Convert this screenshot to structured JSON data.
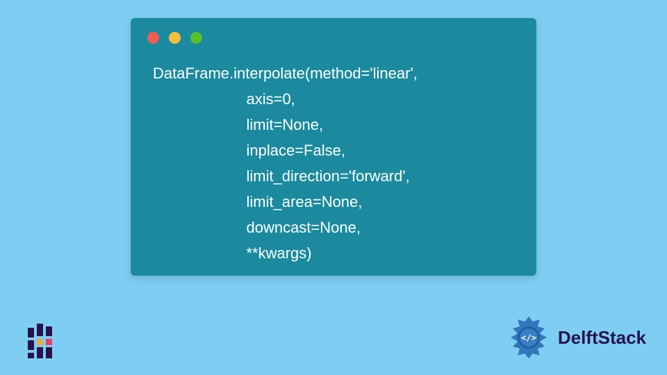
{
  "code": {
    "line1": "DataFrame.interpolate(method='linear',",
    "line2": "                      axis=0,",
    "line3": "                      limit=None,",
    "line4": "                      inplace=False,",
    "line5": "                      limit_direction='forward',",
    "line6": "                      limit_area=None,",
    "line7": "                      downcast=None,",
    "line8": "                      **kwargs)"
  },
  "window": {
    "dot_red": "#ee5c54",
    "dot_yellow": "#f6bd3b",
    "dot_green": "#56c22b"
  },
  "branding": {
    "name": "DelftStack"
  },
  "colors": {
    "page_bg": "#7ecef4",
    "code_bg": "#1b8a9e",
    "code_fg": "#ffffff",
    "brand_dark": "#28134a",
    "brand_blue": "#2b6fb5"
  }
}
